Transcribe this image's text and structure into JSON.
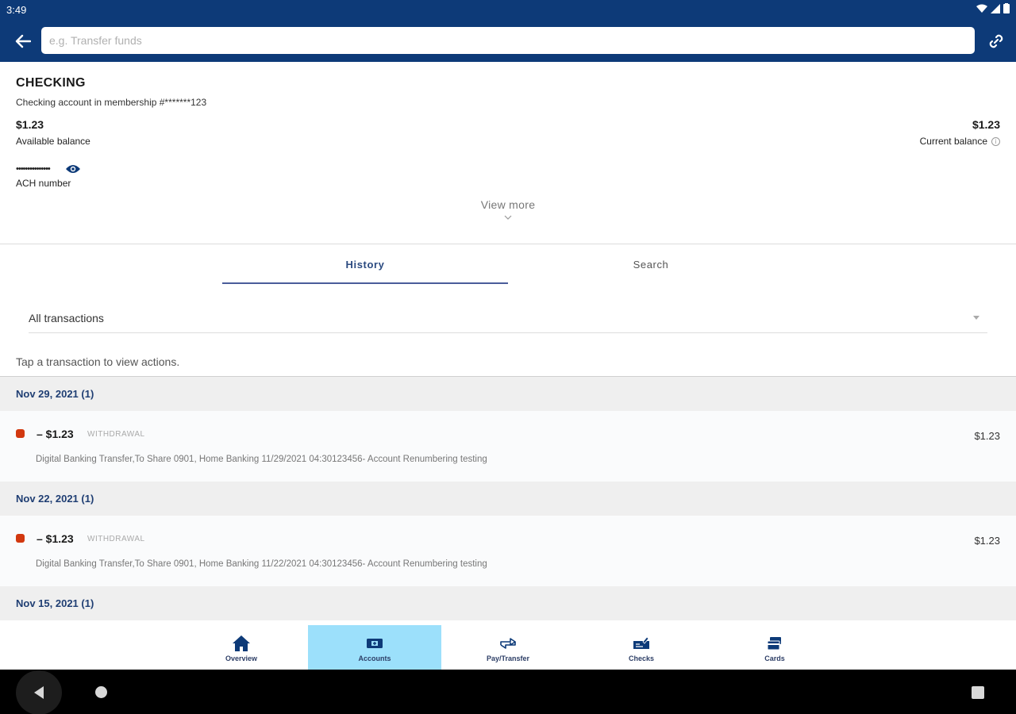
{
  "status_bar": {
    "time": "3:49"
  },
  "search": {
    "placeholder": "e.g. Transfer funds"
  },
  "account": {
    "title": "CHECKING",
    "subtitle": "Checking account in membership #*******123",
    "available_amount": "$1.23",
    "available_label": "Available balance",
    "current_amount": "$1.23",
    "current_label": "Current balance",
    "ach_masked": "•••••••••••••••",
    "ach_label": "ACH number",
    "view_more": "View more"
  },
  "tabs": [
    {
      "label": "History",
      "selected": true
    },
    {
      "label": "Search",
      "selected": false
    }
  ],
  "filter": {
    "selected": "All transactions"
  },
  "hint": "Tap a transaction to view actions.",
  "transactions": [
    {
      "date_header": "Nov 29, 2021 (1)",
      "amount": "– $1.23",
      "type": "WITHDRAWAL",
      "description": "Digital Banking Transfer,To Share 0901, Home Banking 11/29/2021 04:30123456- Account Renumbering testing",
      "right_amount": "$1.23"
    },
    {
      "date_header": "Nov 22, 2021 (1)",
      "amount": "– $1.23",
      "type": "WITHDRAWAL",
      "description": "Digital Banking Transfer,To Share 0901, Home Banking 11/22/2021 04:30123456- Account Renumbering testing",
      "right_amount": "$1.23"
    },
    {
      "date_header": "Nov 15, 2021 (1)"
    }
  ],
  "bottom_nav": [
    {
      "label": "Overview",
      "icon": "home-icon"
    },
    {
      "label": "Accounts",
      "icon": "accounts-icon",
      "active": true
    },
    {
      "label": "Pay/Transfer",
      "icon": "transfer-icon"
    },
    {
      "label": "Checks",
      "icon": "checks-icon"
    },
    {
      "label": "Cards",
      "icon": "cards-icon"
    }
  ],
  "colors": {
    "primary": "#0d3a78",
    "accent_tab": "#4a5d9a",
    "withdrawal_dot": "#d2380f",
    "active_nav": "#9ce0fb",
    "date_header_text": "#1f3e73"
  }
}
